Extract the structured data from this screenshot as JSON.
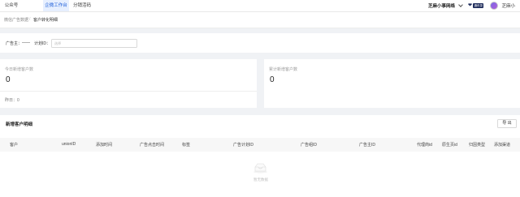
{
  "topbar": {
    "tabs": [
      {
        "label": "公众号",
        "active": false
      },
      {
        "label": "企微工作台",
        "active": true
      },
      {
        "label": "分销活码",
        "active": false
      }
    ],
    "org_name": "芝麻小事网络",
    "org_badge": "通讯录",
    "user_name": "芝麻小",
    "icons": [
      "chevron-down-icon",
      "heart-icon",
      "avatar"
    ]
  },
  "breadcrumb": {
    "items": [
      "微信广告数据",
      "客户转化明细"
    ],
    "separator": "/"
  },
  "filter": {
    "advertiser_label": "广告主：",
    "advertiser_value": "——",
    "plan_id_label": "计划ID：",
    "plan_id_placeholder": "选择"
  },
  "stats": {
    "today": {
      "label": "今日新增客户数",
      "value": "0",
      "footer": "昨日：0"
    },
    "total": {
      "label": "累计新增客户数",
      "value": "0"
    }
  },
  "table": {
    "title": "新增客户明细",
    "export_label": "导 出",
    "columns": [
      "客户",
      "unionID",
      "添加时间",
      "广告点击时间",
      "标签",
      "广告计划ID",
      "广告组ID",
      "广告主ID",
      "代理商id",
      "原生页id",
      "归因类型",
      "添加渠道"
    ],
    "empty_text": "暂无数据"
  },
  "colors": {
    "accent": "#1f5fd9",
    "active_tab_bg": "#e6efff",
    "page_bg": "#f0f2f5",
    "badge_bg": "#1d2b5a"
  }
}
